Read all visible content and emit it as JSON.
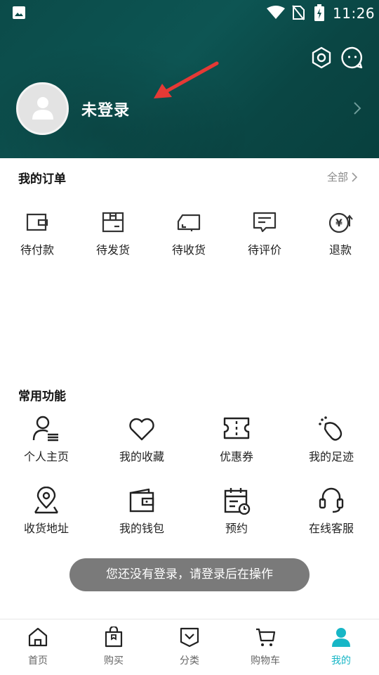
{
  "status_bar": {
    "time": "11:26"
  },
  "header": {
    "login_label": "未登录",
    "icons": [
      "settings-icon",
      "message-icon",
      "avatar-placeholder-icon",
      "chevron-right-icon"
    ]
  },
  "orders": {
    "title": "我的订单",
    "all_label": "全部",
    "items": [
      {
        "label": "待付款",
        "icon": "wallet-icon"
      },
      {
        "label": "待发货",
        "icon": "package-icon"
      },
      {
        "label": "待收货",
        "icon": "truck-icon"
      },
      {
        "label": "待评价",
        "icon": "comment-icon"
      },
      {
        "label": "退款",
        "icon": "refund-icon"
      }
    ]
  },
  "functions": {
    "title": "常用功能",
    "items": [
      {
        "label": "个人主页",
        "icon": "user-profile-icon"
      },
      {
        "label": "我的收藏",
        "icon": "heart-icon"
      },
      {
        "label": "优惠券",
        "icon": "coupon-icon"
      },
      {
        "label": "我的足迹",
        "icon": "footprint-icon"
      },
      {
        "label": "收货地址",
        "icon": "location-icon"
      },
      {
        "label": "我的钱包",
        "icon": "wallet-icon"
      },
      {
        "label": "预约",
        "icon": "calendar-icon"
      },
      {
        "label": "在线客服",
        "icon": "headset-icon"
      }
    ]
  },
  "toast": {
    "text": "您还没有登录，请登录后在操作"
  },
  "bottom_nav": {
    "items": [
      {
        "label": "首页",
        "icon": "home-icon"
      },
      {
        "label": "购买",
        "icon": "shopping-bag-icon"
      },
      {
        "label": "分类",
        "icon": "category-icon"
      },
      {
        "label": "购物车",
        "icon": "cart-icon"
      },
      {
        "label": "我的",
        "icon": "person-icon",
        "active": true
      }
    ]
  },
  "colors": {
    "header_bg": "#0d5553",
    "accent": "#17b6c6",
    "arrow": "#e53935",
    "toast_bg": "#7a7a7a"
  }
}
